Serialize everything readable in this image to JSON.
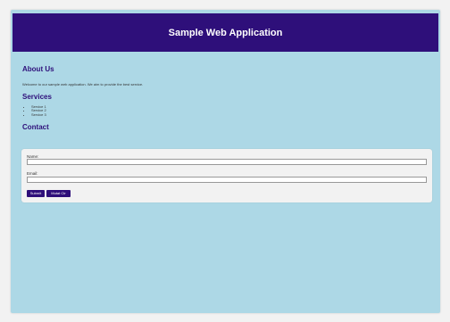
{
  "header": {
    "title": "Sample Web Application"
  },
  "about": {
    "title": "About Us",
    "text": "Welcome to our sample web application. We aim to provide the best service."
  },
  "services": {
    "title": "Services",
    "items": [
      "Service 1",
      "Service 2",
      "Service 3"
    ]
  },
  "contact": {
    "title": "Contact",
    "name_label": "Name:",
    "name_value": "",
    "email_label": "Email:",
    "email_value": "",
    "submit_label": "Submit",
    "second_button_label": "Mutat Ctr"
  },
  "colors": {
    "page_background": "#add8e6",
    "header_background": "#2e0f7a",
    "accent": "#2e0f7a",
    "form_background": "#f2f2f2"
  }
}
